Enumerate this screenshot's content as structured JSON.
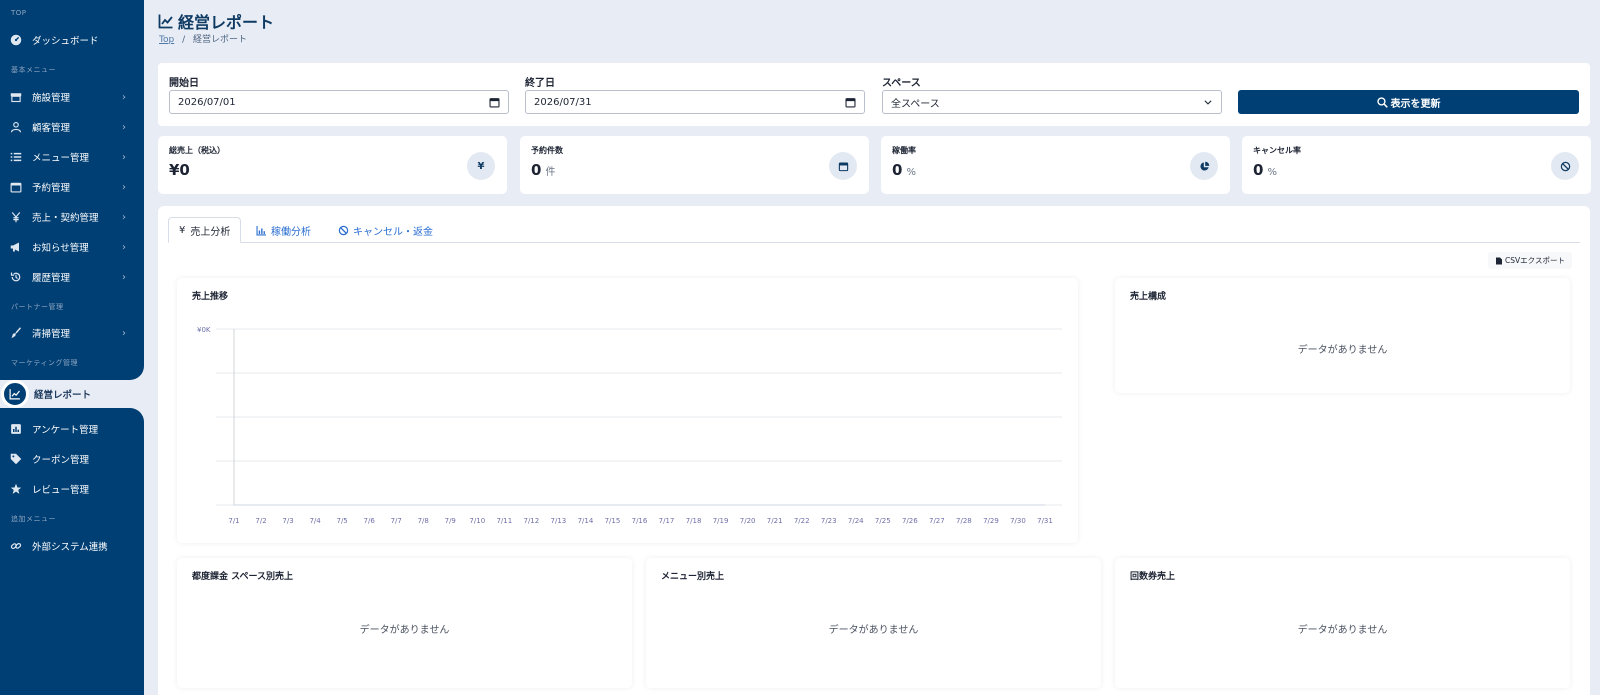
{
  "sidebar": {
    "sections": {
      "top": "TOP",
      "basic": "基本メニュー",
      "partner": "パートナー管理",
      "marketing": "マーケティング管理",
      "extra": "追加メニュー"
    },
    "items": {
      "dashboard": "ダッシュボード",
      "facility": "施設管理",
      "customer": "顧客管理",
      "menu": "メニュー管理",
      "reservation": "予約管理",
      "sales": "売上・契約管理",
      "notice": "お知らせ管理",
      "history": "履歴管理",
      "cleaning": "清掃管理",
      "report": "経営レポート",
      "survey": "アンケート管理",
      "coupon": "クーポン管理",
      "review": "レビュー管理",
      "external": "外部システム連携"
    }
  },
  "header": {
    "title": "経営レポート",
    "breadcrumb_top": "Top",
    "breadcrumb_sep": "/",
    "breadcrumb_current": "経営レポート"
  },
  "filters": {
    "start_label": "開始日",
    "start_value": "2026/07/01",
    "end_label": "終了日",
    "end_value": "2026/07/31",
    "space_label": "スペース",
    "space_value": "全スペース",
    "refresh_label": "表示を更新"
  },
  "kpis": {
    "sales": {
      "label": "総売上（税込）",
      "value": "¥0",
      "unit": "",
      "icon": "¥"
    },
    "bookings": {
      "label": "予約件数",
      "value": "0",
      "unit": "件"
    },
    "utilization": {
      "label": "稼働率",
      "value": "0",
      "unit": "%"
    },
    "cancel": {
      "label": "キャンセル率",
      "value": "0",
      "unit": "%"
    }
  },
  "tabs": {
    "sales": "売上分析",
    "sales_icon": "¥",
    "utilization": "稼働分析",
    "cancel": "キャンセル・返金"
  },
  "csv_label": "CSVエクスポート",
  "cards": {
    "trend_title": "売上推移",
    "composition_title": "売上構成",
    "composition_empty": "データがありません",
    "space_title": "都度課金 スペース別売上",
    "space_empty": "データがありません",
    "menu_title": "メニュー別売上",
    "menu_empty": "データがありません",
    "ticket_title": "回数券売上",
    "ticket_empty": "データがありません"
  },
  "chart_data": {
    "type": "line",
    "title": "売上推移",
    "categories": [
      "7/1",
      "7/2",
      "7/3",
      "7/4",
      "7/5",
      "7/6",
      "7/7",
      "7/8",
      "7/9",
      "7/10",
      "7/11",
      "7/12",
      "7/13",
      "7/14",
      "7/15",
      "7/16",
      "7/17",
      "7/18",
      "7/19",
      "7/20",
      "7/21",
      "7/22",
      "7/23",
      "7/24",
      "7/25",
      "7/26",
      "7/27",
      "7/28",
      "7/29",
      "7/30",
      "7/31"
    ],
    "series": [
      {
        "values": [
          0,
          0,
          0,
          0,
          0,
          0,
          0,
          0,
          0,
          0,
          0,
          0,
          0,
          0,
          0,
          0,
          0,
          0,
          0,
          0,
          0,
          0,
          0,
          0,
          0,
          0,
          0,
          0,
          0,
          0,
          0
        ]
      }
    ],
    "y_tick_labels": [
      "¥0K"
    ],
    "xlabel": "",
    "ylabel": "",
    "grid": true,
    "colors": {
      "grid": "#e6e9ee",
      "axis": "#d0d4da",
      "tick_text": "#6d6fa8"
    }
  }
}
